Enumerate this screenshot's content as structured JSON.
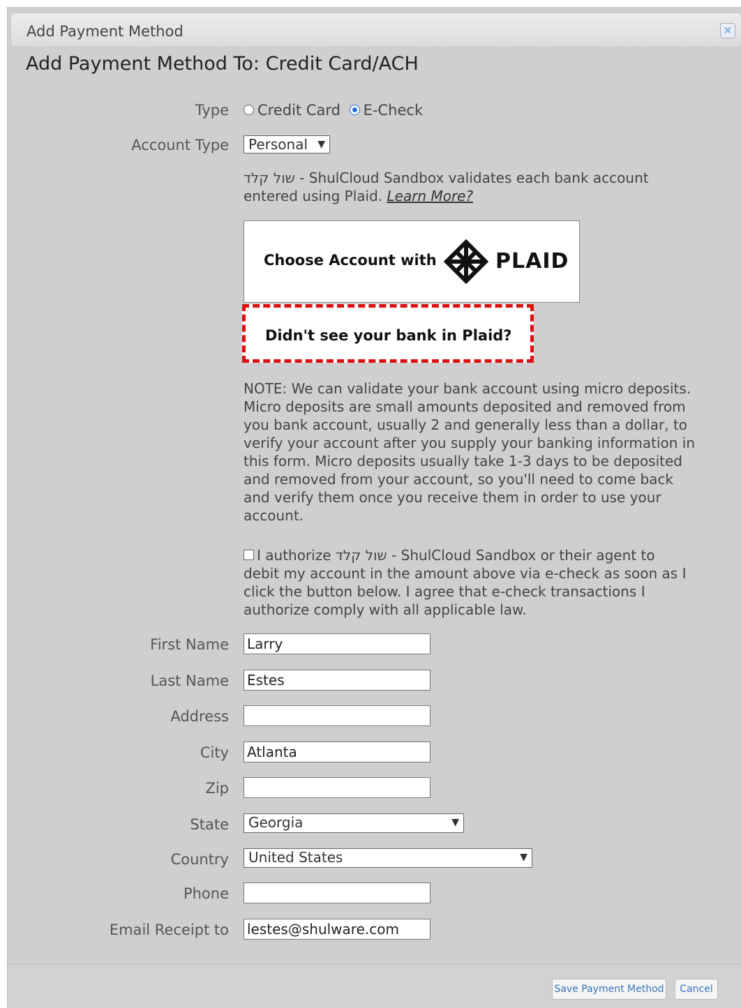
{
  "dialog": {
    "title": "Add Payment Method",
    "close_label": "×",
    "heading": "Add Payment Method To: Credit Card/ACH"
  },
  "type": {
    "label": "Type",
    "options": [
      "Credit Card",
      "E-Check"
    ],
    "selected": "E-Check"
  },
  "account_type": {
    "label": "Account Type",
    "value": "Personal",
    "chevron": "⌄"
  },
  "plaid_info": {
    "line1": "שול קלד - ShulCloud Sandbox validates each bank account",
    "line2": "entered using Plaid.",
    "learn_more": "Learn More?"
  },
  "plaid_button": {
    "label": "Choose Account with",
    "brand": "PLAID"
  },
  "no_bank_button": "Didn't see your bank in Plaid?",
  "note": [
    "NOTE: We can validate your bank account using micro deposits.",
    "Micro deposits are small amounts deposited and removed from",
    "you bank account, usually 2 and generally less than a dollar, to",
    "verify your account after you supply your banking information in",
    "this form. Micro deposits usually take 1-3 days to be deposited",
    "and removed from your account, so you'll need to come back",
    "and verify them once you receive them in order to use your",
    "account."
  ],
  "authorize": [
    "I authorize שול קלד - ShulCloud Sandbox or their agent to",
    "debit my account in the amount above via e-check as soon as I",
    "click the button below. I agree that e-check transactions I",
    "authorize comply with all applicable law."
  ],
  "fields": {
    "first_name": {
      "label": "First Name",
      "value": "Larry"
    },
    "last_name": {
      "label": "Last Name",
      "value": "Estes"
    },
    "address": {
      "label": "Address",
      "value": ""
    },
    "city": {
      "label": "City",
      "value": "Atlanta"
    },
    "zip": {
      "label": "Zip",
      "value": ""
    },
    "state": {
      "label": "State",
      "value": "Georgia"
    },
    "country": {
      "label": "Country",
      "value": "United States"
    },
    "phone": {
      "label": "Phone",
      "value": ""
    },
    "email": {
      "label": "Email Receipt to",
      "value": "lestes@shulware.com"
    }
  },
  "footer": {
    "save_label": "Save Payment Method",
    "cancel_label": "Cancel"
  }
}
